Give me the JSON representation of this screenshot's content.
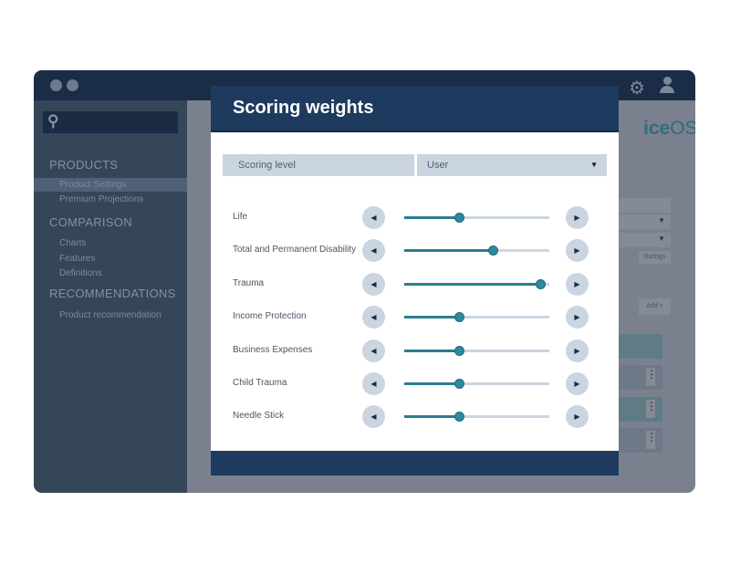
{
  "app": {
    "logo_text_bold": "ice",
    "logo_text": "OS",
    "icons": [
      "gear-icon",
      "user-icon",
      "search-icon"
    ]
  },
  "sidebar": {
    "sections": [
      {
        "title": "PRODUCTS",
        "items": [
          "Product Settings",
          "Premium Projections"
        ]
      },
      {
        "title": "COMPARISON",
        "items": [
          "Charts",
          "Features",
          "Definitions"
        ]
      },
      {
        "title": "RECOMMENDATIONS",
        "items": [
          "Product recommendation"
        ]
      }
    ],
    "active_item": "Product Settings"
  },
  "background": {
    "ratings_label": "Ratings",
    "add_label": "Add +"
  },
  "modal": {
    "title": "Scoring weights",
    "scoring_level_label": "Scoring level",
    "scoring_level_value": "User",
    "weights": [
      {
        "label": "Life",
        "value": 0.38
      },
      {
        "label": "Total and Permanent Disability",
        "value": 0.61
      },
      {
        "label": "Trauma",
        "value": 0.94
      },
      {
        "label": "Income Protection",
        "value": 0.38
      },
      {
        "label": "Business Expenses",
        "value": 0.38
      },
      {
        "label": "Child Trauma",
        "value": 0.38
      },
      {
        "label": "Needle Stick",
        "value": 0.38
      }
    ]
  },
  "colors": {
    "accent": "#2a7d91",
    "header": "#1e3a5f",
    "control": "#cbd5e1"
  }
}
